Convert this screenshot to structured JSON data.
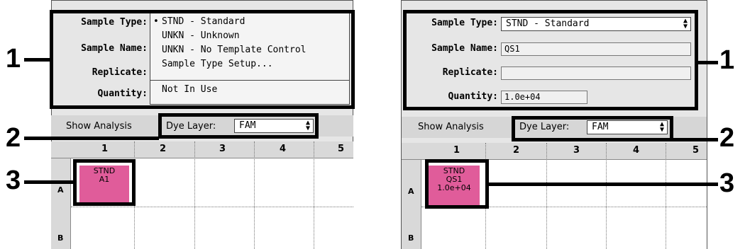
{
  "left": {
    "labels": {
      "sample_type": "Sample Type:",
      "sample_name": "Sample Name:",
      "replicate": "Replicate:",
      "quantity": "Quantity:"
    },
    "menu": {
      "items": [
        "STND - Standard",
        "UNKN - Unknown",
        "UNKN - No Template Control",
        "Sample Type Setup...",
        "Not In Use"
      ],
      "selected_marker": "•"
    },
    "show_analysis": "Show Analysis",
    "dye_layer_label": "Dye Layer:",
    "dye_layer_value": "FAM",
    "columns": [
      "1",
      "2",
      "3",
      "4",
      "5"
    ],
    "rows": [
      "A",
      "B"
    ],
    "well": {
      "type": "STND",
      "name": "A1"
    }
  },
  "right": {
    "labels": {
      "sample_type": "Sample Type:",
      "sample_name": "Sample Name:",
      "replicate": "Replicate:",
      "quantity": "Quantity:"
    },
    "sample_type_value": "STND - Standard",
    "sample_name_value": "QS1",
    "replicate_value": "",
    "quantity_value": "1.0e+04",
    "show_analysis": "Show Analysis",
    "dye_layer_label": "Dye Layer:",
    "dye_layer_value": "FAM",
    "columns": [
      "1",
      "2",
      "3",
      "4",
      "5"
    ],
    "rows": [
      "A",
      "B"
    ],
    "well": {
      "type": "STND",
      "name": "QS1",
      "quantity": "1.0e+04"
    }
  },
  "callouts": {
    "left": [
      "1",
      "2",
      "3"
    ],
    "right": [
      "1",
      "2",
      "3"
    ]
  },
  "colors": {
    "well_fill": "#e05c9a",
    "panel_bg": "#e6e6e6"
  }
}
